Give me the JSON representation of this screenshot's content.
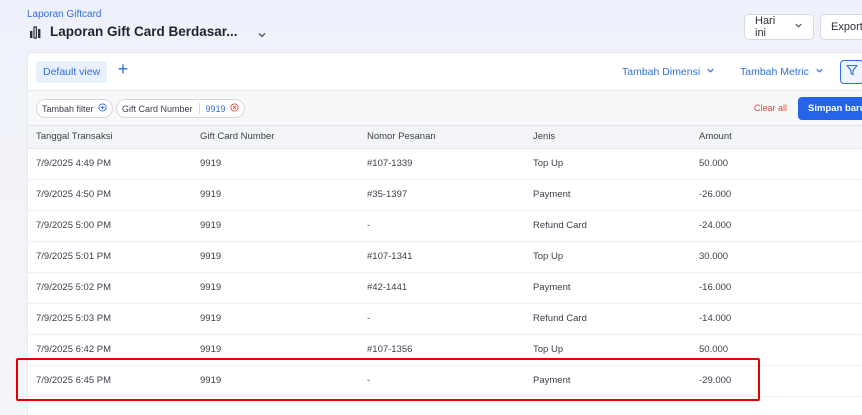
{
  "breadcrumb": "Laporan Giftcard",
  "title": "Laporan Gift Card Berdasar...",
  "toolbar": {
    "date_label": "Hari ini",
    "export_label": "Export"
  },
  "view_bar": {
    "default_view": "Default view",
    "add_view": "+",
    "add_dimension": "Tambah Dimensi",
    "add_metric": "Tambah Metric"
  },
  "filter_bar": {
    "add_filter": "Tambah filter",
    "filter_field": "Gift Card Number",
    "filter_value": "9919",
    "clear_all": "Clear all",
    "save_new": "Simpan baru"
  },
  "table": {
    "columns": [
      "Tanggal Transaksi",
      "Gift Card Number",
      "Nomor Pesanan",
      "Jenis",
      "Amount"
    ],
    "rows": [
      [
        "7/9/2025 4:49 PM",
        "9919",
        "#107-1339",
        "Top Up",
        "50.000"
      ],
      [
        "7/9/2025 4:50 PM",
        "9919",
        "#35-1397",
        "Payment",
        "-26.000"
      ],
      [
        "7/9/2025 5:00 PM",
        "9919",
        "-",
        "Refund Card",
        "-24.000"
      ],
      [
        "7/9/2025 5:01 PM",
        "9919",
        "#107-1341",
        "Top Up",
        "30.000"
      ],
      [
        "7/9/2025 5:02 PM",
        "9919",
        "#42-1441",
        "Payment",
        "-16.000"
      ],
      [
        "7/9/2025 5:03 PM",
        "9919",
        "-",
        "Refund Card",
        "-14.000"
      ],
      [
        "7/9/2025 6:42 PM",
        "9919",
        "#107-1356",
        "Top Up",
        "50.000"
      ],
      [
        "7/9/2025 6:45 PM",
        "9919",
        "-",
        "Payment",
        "-29.000"
      ]
    ]
  },
  "colors": {
    "accent": "#2f6fde",
    "primary_button": "#2563eb",
    "highlight": "#e00000",
    "danger": "#e0453a"
  }
}
